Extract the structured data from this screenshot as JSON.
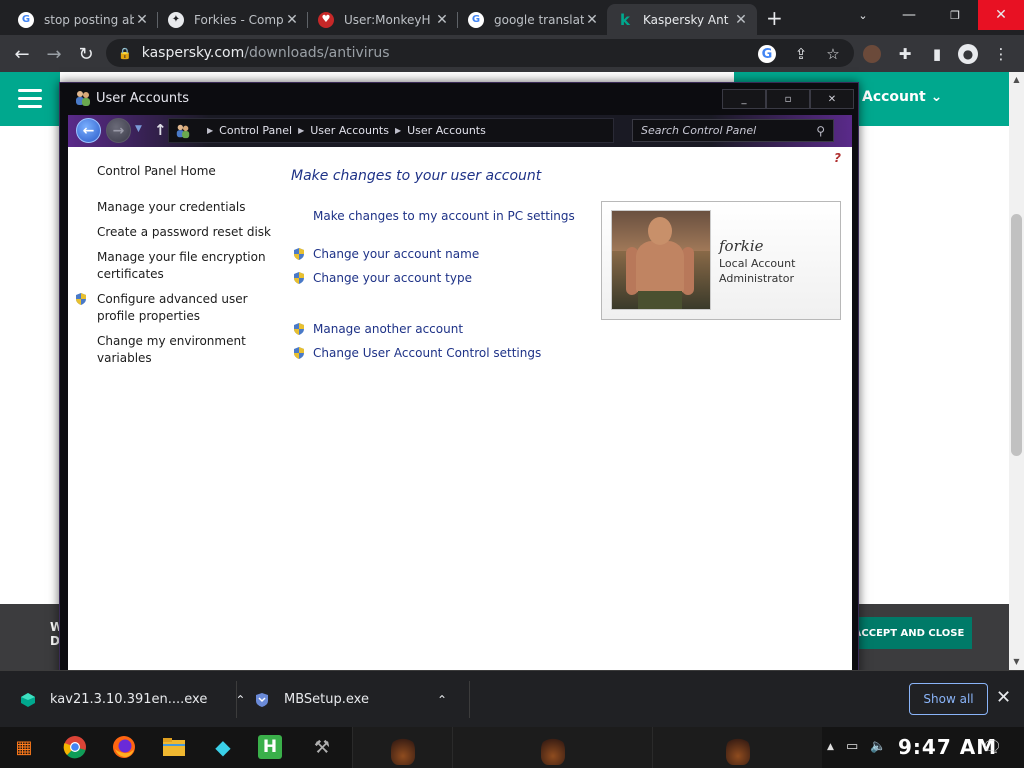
{
  "browser": {
    "tabs": [
      {
        "title": "stop posting ab",
        "favicon": "google-icon"
      },
      {
        "title": "Forkies - Comp",
        "favicon": "fandom-icon"
      },
      {
        "title": "User:MonkeyH",
        "favicon": "wiki-icon"
      },
      {
        "title": "google translat",
        "favicon": "google-icon"
      },
      {
        "title": "Kaspersky Ant",
        "favicon": "kaspersky-icon",
        "active": true
      }
    ],
    "new_tab_label": "+",
    "url_host": "kaspersky.com",
    "url_path": "/downloads/antivirus"
  },
  "kaspersky_page": {
    "account_label": "Account",
    "cookie_text_line1": "W",
    "cookie_text_line2": "D",
    "accept_label": "ACCEPT AND CLOSE",
    "brand_color": "#00a88e"
  },
  "user_accounts": {
    "window_title": "User Accounts",
    "breadcrumb": [
      "Control Panel",
      "User Accounts",
      "User Accounts"
    ],
    "search_placeholder": "Search Control Panel",
    "help_label": "?",
    "sidebar": {
      "home": "Control Panel Home",
      "credentials": "Manage your credentials",
      "reset_disk": "Create a password reset disk",
      "encryption": "Manage your file encryption certificates",
      "advanced_profile": "Configure advanced user profile properties",
      "env_vars": "Change my environment variables"
    },
    "heading": "Make changes to your user account",
    "links": {
      "pc_settings": "Make changes to my account in PC settings",
      "change_name": "Change your account name",
      "change_type": "Change your account type",
      "manage_other": "Manage another account",
      "uac_settings": "Change User Account Control settings"
    },
    "account": {
      "name": "forkie",
      "type": "Local Account",
      "role": "Administrator"
    }
  },
  "downloads": {
    "items": [
      {
        "name": "kav21.3.10.391en....exe",
        "icon": "kaspersky-installer-icon"
      },
      {
        "name": "MBSetup.exe",
        "icon": "malwarebytes-icon"
      }
    ],
    "show_all": "Show all"
  },
  "taskbar": {
    "apps": [
      "start-icon",
      "chrome-icon",
      "firefox-icon",
      "file-explorer-icon",
      "gem-icon",
      "h-app-icon",
      "tool-icon"
    ],
    "clock": "9:47 AM"
  }
}
